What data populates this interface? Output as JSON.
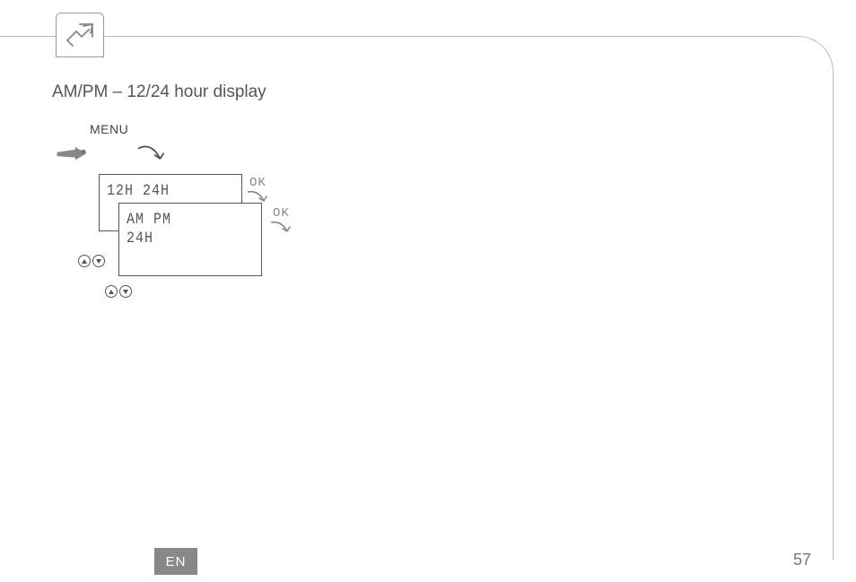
{
  "heading": "AM/PM – 12/24 hour display",
  "menu_label": "MENU",
  "screen1": {
    "line1": "12H 24H"
  },
  "screen2": {
    "line1": "AM PM",
    "line2": "24H"
  },
  "ok_label_1": "OK",
  "ok_label_2": "OK",
  "lang_badge": "EN",
  "page_number": "57"
}
